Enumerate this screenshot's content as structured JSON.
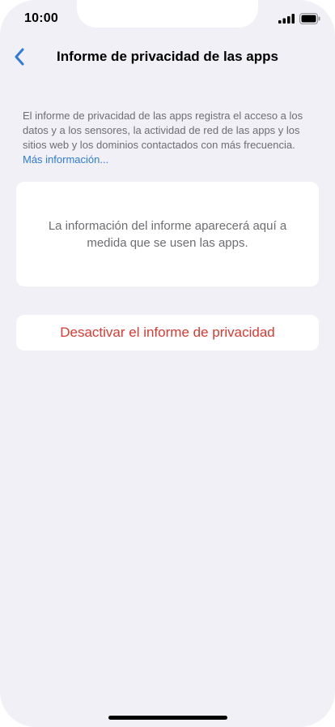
{
  "status_bar": {
    "time": "10:00"
  },
  "nav": {
    "title": "Informe de privacidad de las apps",
    "back_icon": "chevron-left-icon"
  },
  "description": {
    "text": "El informe de privacidad de las apps registra el acceso a los datos y a los sensores, la actividad de red de las apps y los sitios web y los dominios contactados con más frecuencia. ",
    "link_label": "Más información..."
  },
  "info_card": {
    "text": "La información del informe aparecerá aquí a medida que se usen las apps."
  },
  "disable_button": {
    "label": "Desactivar el informe de privacidad"
  },
  "colors": {
    "background": "#f0f0f6",
    "accent": "#2f7bd9",
    "destructive": "#d93a32"
  }
}
